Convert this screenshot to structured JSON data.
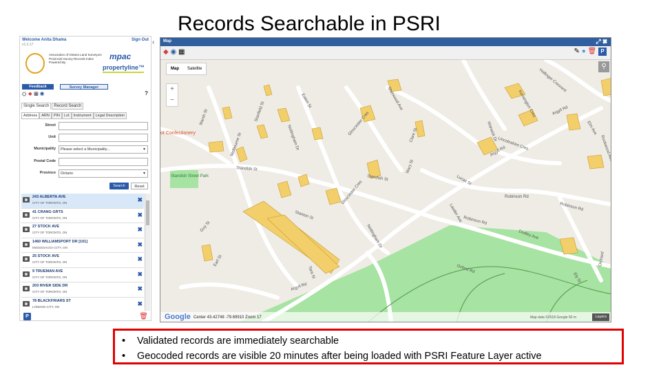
{
  "slide": {
    "title": "Records Searchable in PSRI"
  },
  "left_panel": {
    "welcome": "Welcome Anita Dhama",
    "version": "v1.2.17",
    "sign_out": "Sign Out",
    "assoc_text": "Association of Ontario Land Surveyors Provincial Survey Records Index Powered By",
    "mpac": "mpac",
    "propertyline": "propertyline™",
    "tab_feedback": "Feedback",
    "tab_survey_manager": "Survey Manager",
    "search_tabs": [
      "Single Search",
      "Record Search"
    ],
    "sub_tabs": [
      "Address",
      "ARN",
      "PIN",
      "Lot",
      "Instrument",
      "Legal Description"
    ],
    "fields": [
      {
        "label": "Street",
        "value": ""
      },
      {
        "label": "Unit",
        "value": ""
      },
      {
        "label": "Municipality",
        "value": "Please select a Municipality..."
      },
      {
        "label": "Postal Code",
        "value": ""
      },
      {
        "label": "Province",
        "value": "Ontario"
      }
    ],
    "search_btn": "Search",
    "reset_btn": "Reset",
    "results": [
      {
        "line1": "243 ALBERTA AVE",
        "line2": "CITY OF TORONTO, ON"
      },
      {
        "line1": "41 CRANG GRTS",
        "line2": "CITY OF TORONTO, ON"
      },
      {
        "line1": "27 STOCK AVE",
        "line2": "CITY OF TORONTO, ON"
      },
      {
        "line1": "1460 WILLIAMSPORT DR [101]",
        "line2": "MISSISSAUGA CITY, ON"
      },
      {
        "line1": "25 STOCK AVE",
        "line2": "CITY OF TORONTO, ON"
      },
      {
        "line1": "9 TRUEMAN AVE",
        "line2": "CITY OF TORONTO, ON"
      },
      {
        "line1": "203 RIVER SIDE DR",
        "line2": "CITY OF TORONTO, ON"
      },
      {
        "line1": "78 BLACKFRIARS ST",
        "line2": "LONDON CITY, ON"
      }
    ],
    "p_badge": "P"
  },
  "map": {
    "title": "Map",
    "type_map": "Map",
    "type_satellite": "Satellite",
    "zoom_in": "+",
    "zoom_out": "−",
    "google": "Google",
    "center": "Center 43.42748 -79.69910 Zoom 17",
    "mapdata": "Map data ©2018 Google   50 m",
    "layers": "Layers",
    "p_btn": "P",
    "labels": [
      {
        "text": "Argyll Rd"
      },
      {
        "text": "Argyll Rd"
      },
      {
        "text": "Argyll Rd"
      },
      {
        "text": "Standish St"
      },
      {
        "text": "Standish St"
      },
      {
        "text": "Stanton St"
      },
      {
        "text": "Robinson Rd"
      },
      {
        "text": "Robinson Rd"
      },
      {
        "text": "Robinson Rd"
      },
      {
        "text": "Nottingham Dr"
      },
      {
        "text": "Nottingham Dr"
      },
      {
        "text": "Gloucester Cres"
      },
      {
        "text": "Gloucester Cres"
      },
      {
        "text": "Sherwood Ave"
      },
      {
        "text": "Lincolnshire Cres"
      },
      {
        "text": "Kensington Cres"
      },
      {
        "text": "Warwick Dr"
      },
      {
        "text": "Marsh St"
      },
      {
        "text": "Melbourne St"
      },
      {
        "text": "Stanfield St"
      },
      {
        "text": "Earl St"
      },
      {
        "text": "Eaton St"
      },
      {
        "text": "Clare St"
      },
      {
        "text": "Guy St"
      },
      {
        "text": "Lucas St"
      },
      {
        "text": "Ely St"
      },
      {
        "text": "Lauder Ave"
      },
      {
        "text": "Mary St"
      },
      {
        "text": "Hollinger Crescent"
      },
      {
        "text": "Elm Ave"
      },
      {
        "text": "Rockwood Ave"
      },
      {
        "text": "Dudley Ave"
      },
      {
        "text": "Tara St"
      },
      {
        "text": "Oxford Rd"
      },
      {
        "text": "Orchard"
      },
      {
        "text": "Standish Street Park"
      },
      {
        "text": "ot Confectionery"
      }
    ]
  },
  "notes": [
    "Validated records are immediately searchable",
    "Geocoded records are visible 20 minutes after being loaded with PSRI Feature Layer active"
  ],
  "colors": {
    "accent": "#2a5aa8",
    "parcel": "#f2cf6a",
    "park": "#a7e3a2",
    "note_border": "#e00000"
  }
}
